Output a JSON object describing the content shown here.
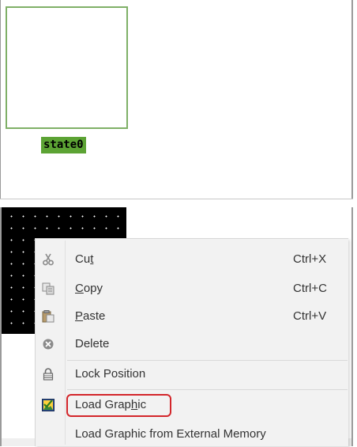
{
  "top_panel": {
    "state_label": "state0"
  },
  "context_menu": {
    "items": [
      {
        "name": "cut",
        "label_pre": "Cu",
        "label_ul": "t",
        "label_post": "",
        "shortcut": "Ctrl+X",
        "icon": "scissors-icon"
      },
      {
        "name": "copy",
        "label_pre": "",
        "label_ul": "C",
        "label_post": "opy",
        "shortcut": "Ctrl+C",
        "icon": "copy-icon"
      },
      {
        "name": "paste",
        "label_pre": "",
        "label_ul": "P",
        "label_post": "aste",
        "shortcut": "Ctrl+V",
        "icon": "paste-icon"
      },
      {
        "name": "delete",
        "label": "Delete",
        "shortcut": "",
        "icon": "delete-icon"
      },
      {
        "name": "lock-position",
        "label": "Lock Position",
        "shortcut": "",
        "icon": "lock-icon"
      },
      {
        "name": "load-graphic",
        "label_pre": "Load Grap",
        "label_ul": "h",
        "label_post": "ic",
        "shortcut": "",
        "icon": "load-graphic-icon",
        "highlighted": true
      },
      {
        "name": "load-graphic-external",
        "label": "Load Graphic from External Memory",
        "shortcut": ""
      }
    ]
  },
  "colors": {
    "state_border": "#7fb067",
    "state_label_bg": "#5ca334",
    "highlight_ring": "#d3262b",
    "menu_bg": "#f2f2f2"
  }
}
